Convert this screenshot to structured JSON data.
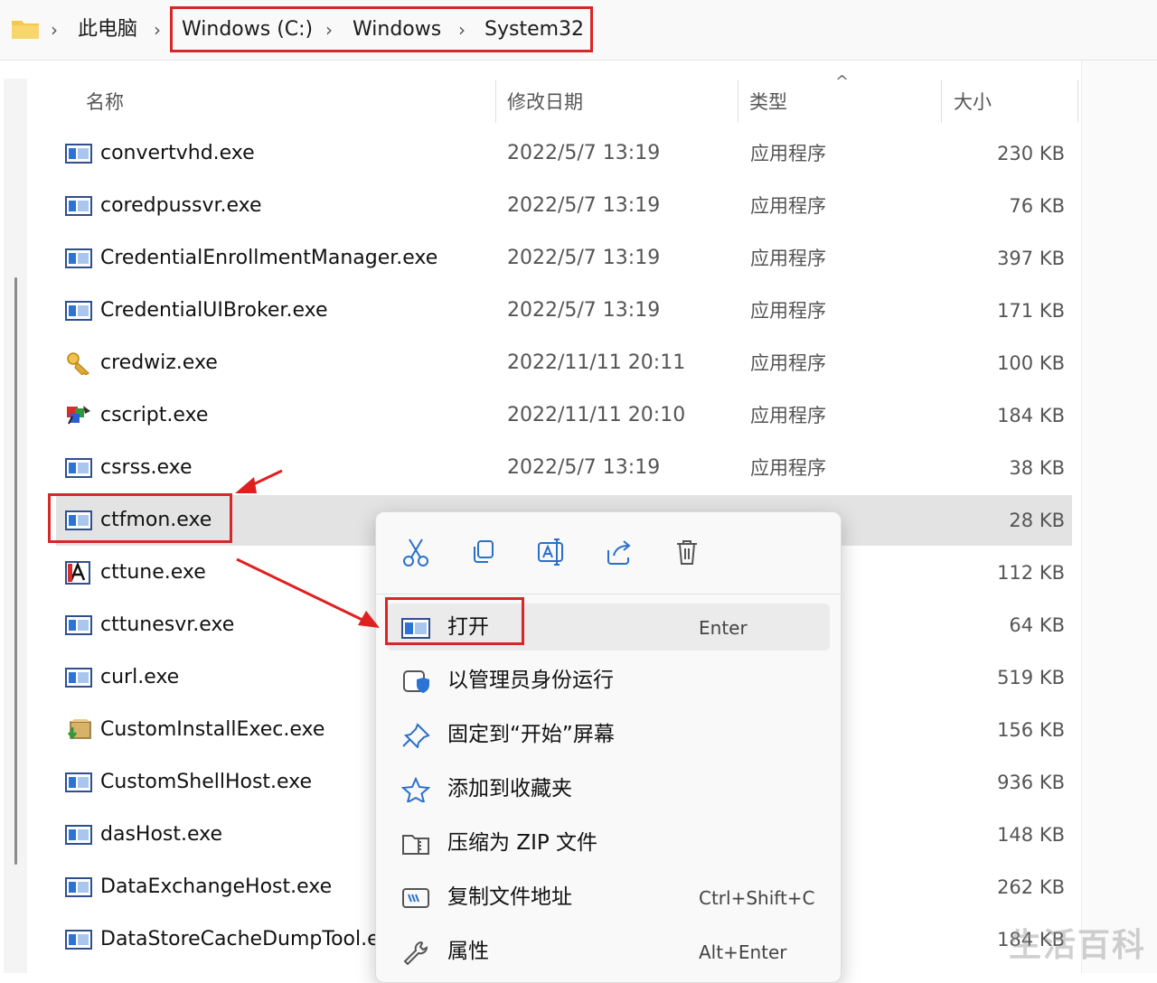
{
  "address": {
    "crumbs": [
      "此电脑",
      "Windows (C:)",
      "Windows",
      "System32"
    ]
  },
  "columns": {
    "name": "名称",
    "date": "修改日期",
    "type": "类型",
    "size": "大小"
  },
  "files": [
    {
      "name": "convertvhd.exe",
      "date": "2022/5/7 13:19",
      "type": "应用程序",
      "size": "230 KB",
      "icon": "app-window-icon"
    },
    {
      "name": "coredpussvr.exe",
      "date": "2022/5/7 13:19",
      "type": "应用程序",
      "size": "76 KB",
      "icon": "app-window-icon"
    },
    {
      "name": "CredentialEnrollmentManager.exe",
      "date": "2022/5/7 13:19",
      "type": "应用程序",
      "size": "397 KB",
      "icon": "app-window-icon"
    },
    {
      "name": "CredentialUIBroker.exe",
      "date": "2022/5/7 13:19",
      "type": "应用程序",
      "size": "171 KB",
      "icon": "app-window-icon"
    },
    {
      "name": "credwiz.exe",
      "date": "2022/11/11 20:11",
      "type": "应用程序",
      "size": "100 KB",
      "icon": "key-icon"
    },
    {
      "name": "cscript.exe",
      "date": "2022/11/11 20:10",
      "type": "应用程序",
      "size": "184 KB",
      "icon": "script-icon"
    },
    {
      "name": "csrss.exe",
      "date": "2022/5/7 13:19",
      "type": "应用程序",
      "size": "38 KB",
      "icon": "app-window-icon"
    },
    {
      "name": "ctfmon.exe",
      "date": "",
      "type": "",
      "size": "28 KB",
      "icon": "app-window-icon",
      "selected": true
    },
    {
      "name": "cttune.exe",
      "date": "",
      "type": "",
      "size": "112 KB",
      "icon": "font-a-icon"
    },
    {
      "name": "cttunesvr.exe",
      "date": "",
      "type": "",
      "size": "64 KB",
      "icon": "app-window-icon"
    },
    {
      "name": "curl.exe",
      "date": "",
      "type": "",
      "size": "519 KB",
      "icon": "app-window-icon"
    },
    {
      "name": "CustomInstallExec.exe",
      "date": "",
      "type": "",
      "size": "156 KB",
      "icon": "installer-icon"
    },
    {
      "name": "CustomShellHost.exe",
      "date": "",
      "type": "",
      "size": "936 KB",
      "icon": "app-window-icon"
    },
    {
      "name": "dasHost.exe",
      "date": "",
      "type": "",
      "size": "148 KB",
      "icon": "app-window-icon"
    },
    {
      "name": "DataExchangeHost.exe",
      "date": "",
      "type": "",
      "size": "262 KB",
      "icon": "app-window-icon"
    },
    {
      "name": "DataStoreCacheDumpTool.e",
      "date": "",
      "type": "",
      "size": "184 KB",
      "icon": "app-window-icon"
    }
  ],
  "context_menu": {
    "quick_actions": [
      "cut-icon",
      "copy-icon",
      "rename-icon",
      "share-icon",
      "delete-icon"
    ],
    "items": [
      {
        "label": "打开",
        "shortcut": "Enter",
        "icon": "app-window-icon"
      },
      {
        "label": "以管理员身份运行",
        "shortcut": "",
        "icon": "shield-icon"
      },
      {
        "label": "固定到“开始”屏幕",
        "shortcut": "",
        "icon": "pin-icon"
      },
      {
        "label": "添加到收藏夹",
        "shortcut": "",
        "icon": "star-icon"
      },
      {
        "label": "压缩为 ZIP 文件",
        "shortcut": "",
        "icon": "zip-folder-icon"
      },
      {
        "label": "复制文件地址",
        "shortcut": "Ctrl+Shift+C",
        "icon": "path-icon"
      },
      {
        "label": "属性",
        "shortcut": "Alt+Enter",
        "icon": "wrench-icon"
      }
    ]
  },
  "watermark": "生活百科",
  "colors": {
    "highlight": "#d62828",
    "selected_row": "#e3e3e3",
    "accent_blue": "#2b73d4"
  }
}
